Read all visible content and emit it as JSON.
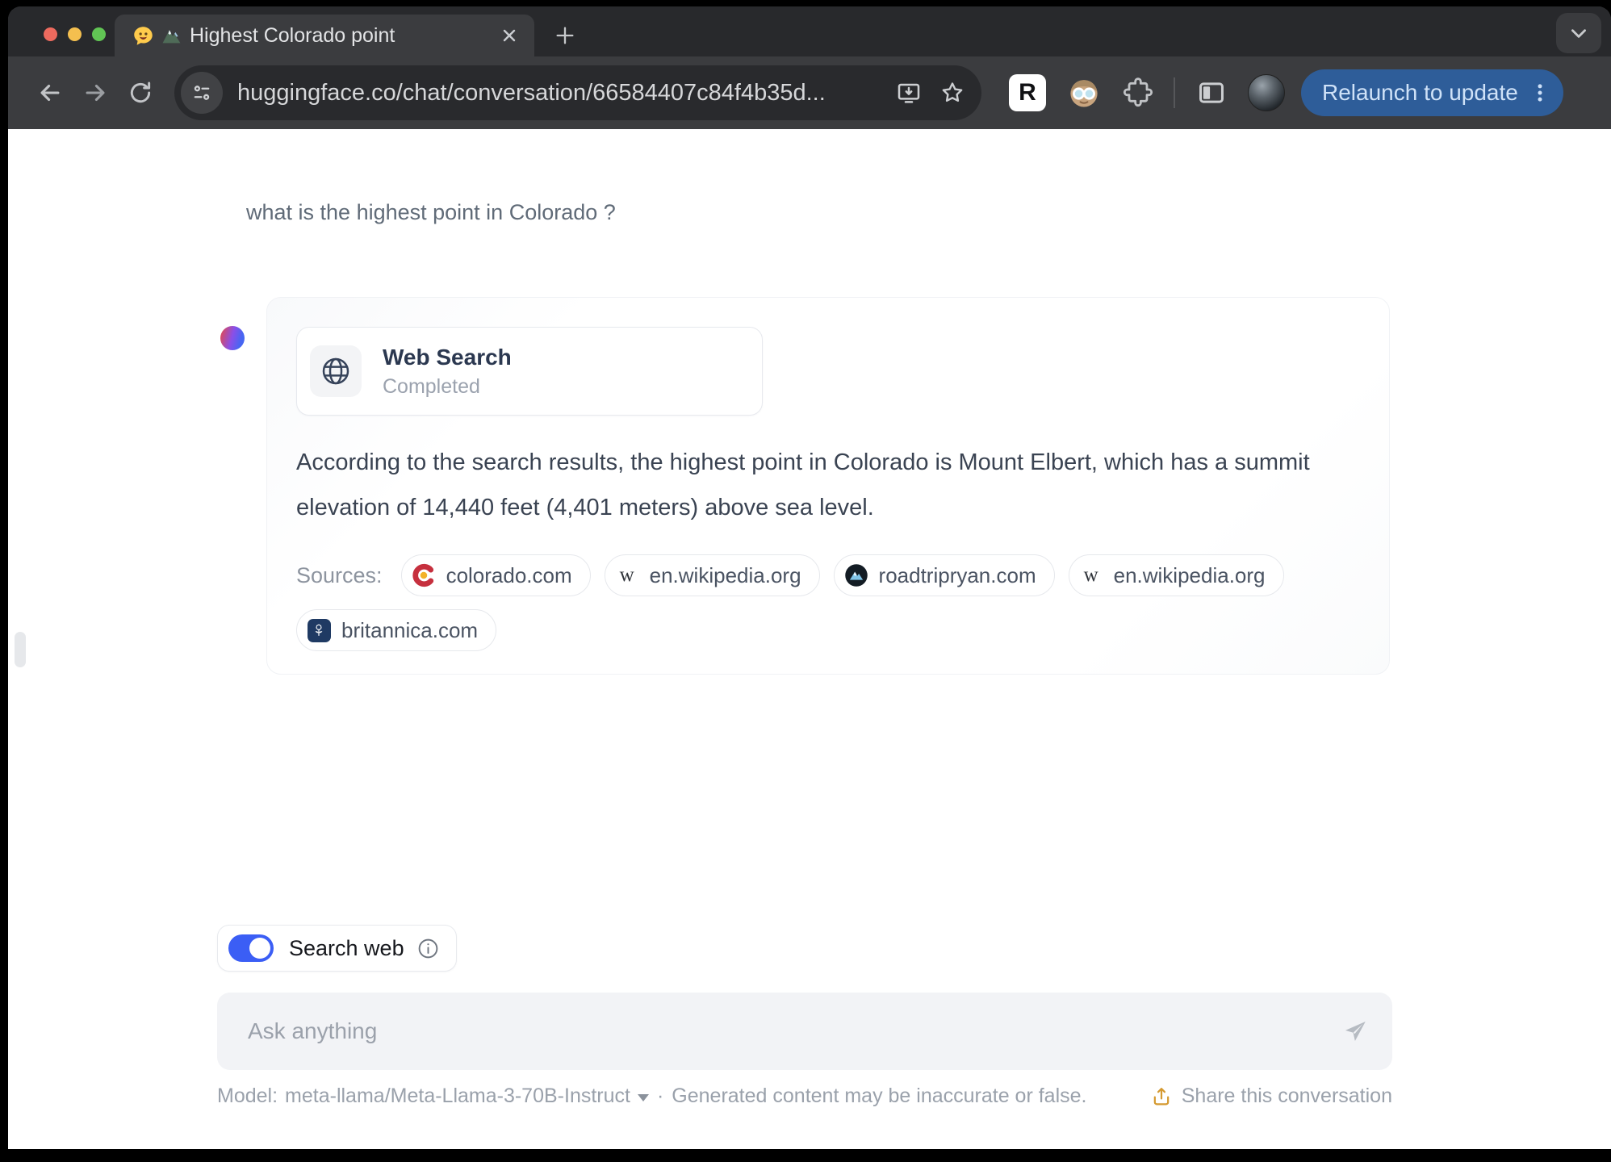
{
  "browser": {
    "tab": {
      "title": "Highest Colorado point"
    },
    "url": "huggingface.co/chat/conversation/66584407c84f4b35d...",
    "relaunch_label": "Relaunch to update",
    "extension_r_glyph": "R"
  },
  "chat": {
    "user_message": "what is the highest point in Colorado ?",
    "tool": {
      "name": "Web Search",
      "status": "Completed"
    },
    "answer": "According to the search results, the highest point in Colorado is Mount Elbert, which has a summit elevation of 14,440 feet (4,401 meters) above sea level.",
    "sources": {
      "label": "Sources:",
      "wikipedia_glyph": "w",
      "items": [
        {
          "domain": "colorado.com"
        },
        {
          "domain": "en.wikipedia.org"
        },
        {
          "domain": "roadtripryan.com"
        },
        {
          "domain": "en.wikipedia.org"
        },
        {
          "domain": "britannica.com"
        }
      ]
    }
  },
  "composer": {
    "search_web_label": "Search web",
    "placeholder": "Ask anything"
  },
  "footer": {
    "model_label": "Model:",
    "model_name": "meta-llama/Meta-Llama-3-70B-Instruct",
    "separator": "·",
    "disclaimer": "Generated content may be inaccurate or false.",
    "share_label": "Share this conversation"
  },
  "colors": {
    "toggle_accent_blue": "#3b5ef5",
    "relaunch_button_blue": "#2e5d99",
    "share_icon_orange": "#d59a31",
    "traffic_red": "#ed6a5e",
    "traffic_yellow": "#f4bf4f",
    "traffic_green": "#61c554"
  }
}
